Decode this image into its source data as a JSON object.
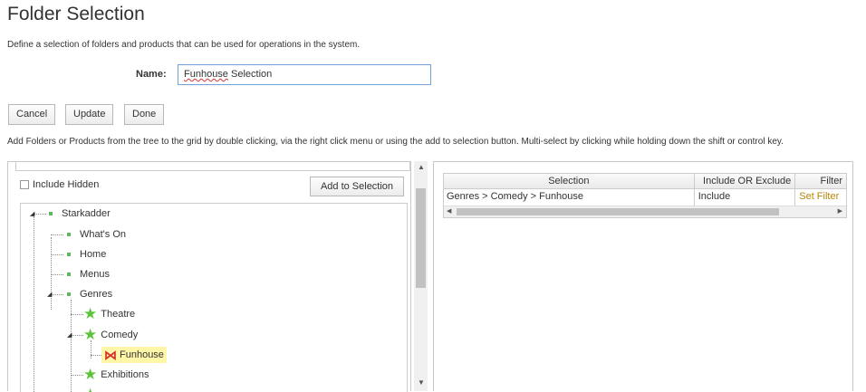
{
  "page": {
    "title": "Folder Selection",
    "description": "Define a selection of folders and products that can be used for operations in the system."
  },
  "form": {
    "name_label": "Name:",
    "name_value_word1": "Funhouse",
    "name_value_word2": " Selection"
  },
  "toolbar": {
    "cancel_label": "Cancel",
    "update_label": "Update",
    "done_label": "Done"
  },
  "help_text": "Add Folders or Products from the tree to the grid by double clicking, via the right click menu or using the add to selection button. Multi-select by clicking while holding down the shift or control key.",
  "left_panel": {
    "include_hidden_label": "Include Hidden",
    "add_button_label": "Add to Selection",
    "tree": {
      "root": "Starkadder",
      "items": [
        "What's On",
        "Home",
        "Menus",
        "Genres"
      ],
      "genres_children": [
        "Theatre",
        "Comedy",
        "Exhibitions"
      ],
      "comedy_children": [
        "Funhouse"
      ]
    }
  },
  "grid": {
    "headers": [
      "Selection",
      "Include OR Exclude",
      "Filter"
    ],
    "rows": [
      {
        "selection": "Genres > Comedy > Funhouse",
        "include": "Include",
        "filter": "Set Filter"
      }
    ]
  },
  "icons": {
    "folder": "green-square-icon",
    "category": "green-star-icon",
    "product": "red-bowtie-icon"
  },
  "colors": {
    "accent_blue": "#6fa0d8",
    "star_green": "#5cc43a",
    "selected_bg": "#fff6a8",
    "link_gold": "#b8860b",
    "product_red": "#d9302c"
  }
}
